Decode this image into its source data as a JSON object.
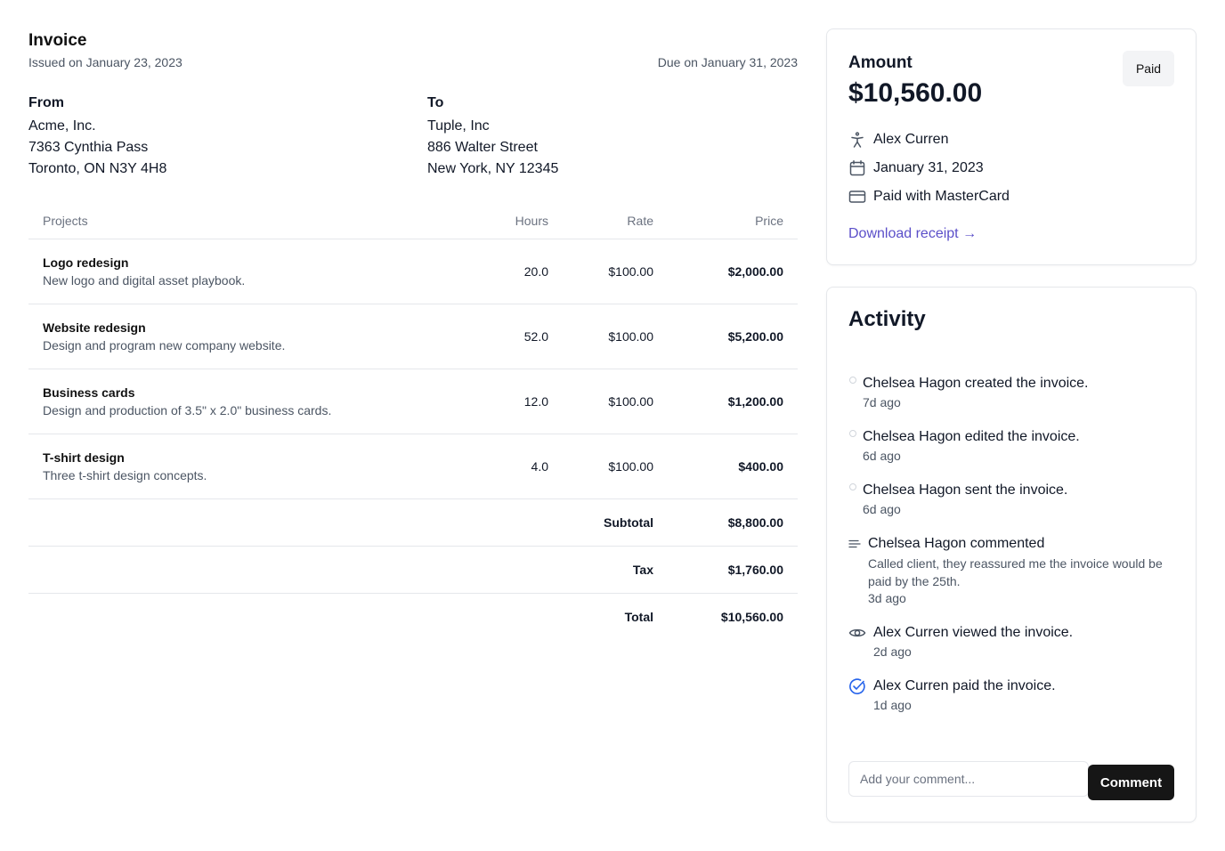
{
  "invoice": {
    "title": "Invoice",
    "issued": "Issued on January 23, 2023",
    "due": "Due on January 31, 2023",
    "from": {
      "label": "From",
      "lines": [
        "Acme, Inc.",
        "7363 Cynthia Pass",
        "Toronto, ON N3Y 4H8"
      ]
    },
    "to": {
      "label": "To",
      "lines": [
        "Tuple, Inc",
        "886 Walter Street",
        "New York, NY 12345"
      ]
    },
    "columns": {
      "projects": "Projects",
      "hours": "Hours",
      "rate": "Rate",
      "price": "Price"
    },
    "items": [
      {
        "name": "Logo redesign",
        "description": "New logo and digital asset playbook.",
        "hours": "20.0",
        "rate": "$100.00",
        "price": "$2,000.00"
      },
      {
        "name": "Website redesign",
        "description": "Design and program new company website.",
        "hours": "52.0",
        "rate": "$100.00",
        "price": "$5,200.00"
      },
      {
        "name": "Business cards",
        "description": "Design and production of 3.5\" x 2.0\" business cards.",
        "hours": "12.0",
        "rate": "$100.00",
        "price": "$1,200.00"
      },
      {
        "name": "T-shirt design",
        "description": "Three t-shirt design concepts.",
        "hours": "4.0",
        "rate": "$100.00",
        "price": "$400.00"
      }
    ],
    "totals": [
      {
        "label": "Subtotal",
        "value": "$8,800.00"
      },
      {
        "label": "Tax",
        "value": "$1,760.00"
      },
      {
        "label": "Total",
        "value": "$10,560.00"
      }
    ]
  },
  "summary": {
    "amount_label": "Amount",
    "amount_value": "$10,560.00",
    "status": "Paid",
    "client": {
      "icon": "person-icon",
      "text": "Alex Curren"
    },
    "date": {
      "icon": "calendar-icon",
      "text": "January 31, 2023"
    },
    "payment": {
      "icon": "credit-card-icon",
      "text": "Paid with MasterCard"
    },
    "download_link": "Download receipt →",
    "colors": {
      "link": "#5b4fc9",
      "paid_check": "#2563eb"
    }
  },
  "activity": {
    "title": "Activity",
    "items": [
      {
        "type": "event",
        "text": "Chelsea Hagon created the invoice.",
        "time": "7d ago"
      },
      {
        "type": "event",
        "text": "Chelsea Hagon edited the invoice.",
        "time": "6d ago"
      },
      {
        "type": "event",
        "text": "Chelsea Hagon sent the invoice.",
        "time": "6d ago"
      },
      {
        "type": "comment",
        "icon": "comment-lines-icon",
        "text": "Chelsea Hagon commented",
        "comment": "Called client, they reassured me the invoice would be paid by the 25th.",
        "time": "3d ago"
      },
      {
        "type": "event",
        "icon": "eye-icon",
        "text": "Alex Curren viewed the invoice.",
        "time": "2d ago"
      },
      {
        "type": "event",
        "icon": "check-circle-icon",
        "text": "Alex Curren paid the invoice.",
        "time": "1d ago"
      }
    ],
    "comment_placeholder": "Add your comment...",
    "comment_button": "Comment"
  }
}
